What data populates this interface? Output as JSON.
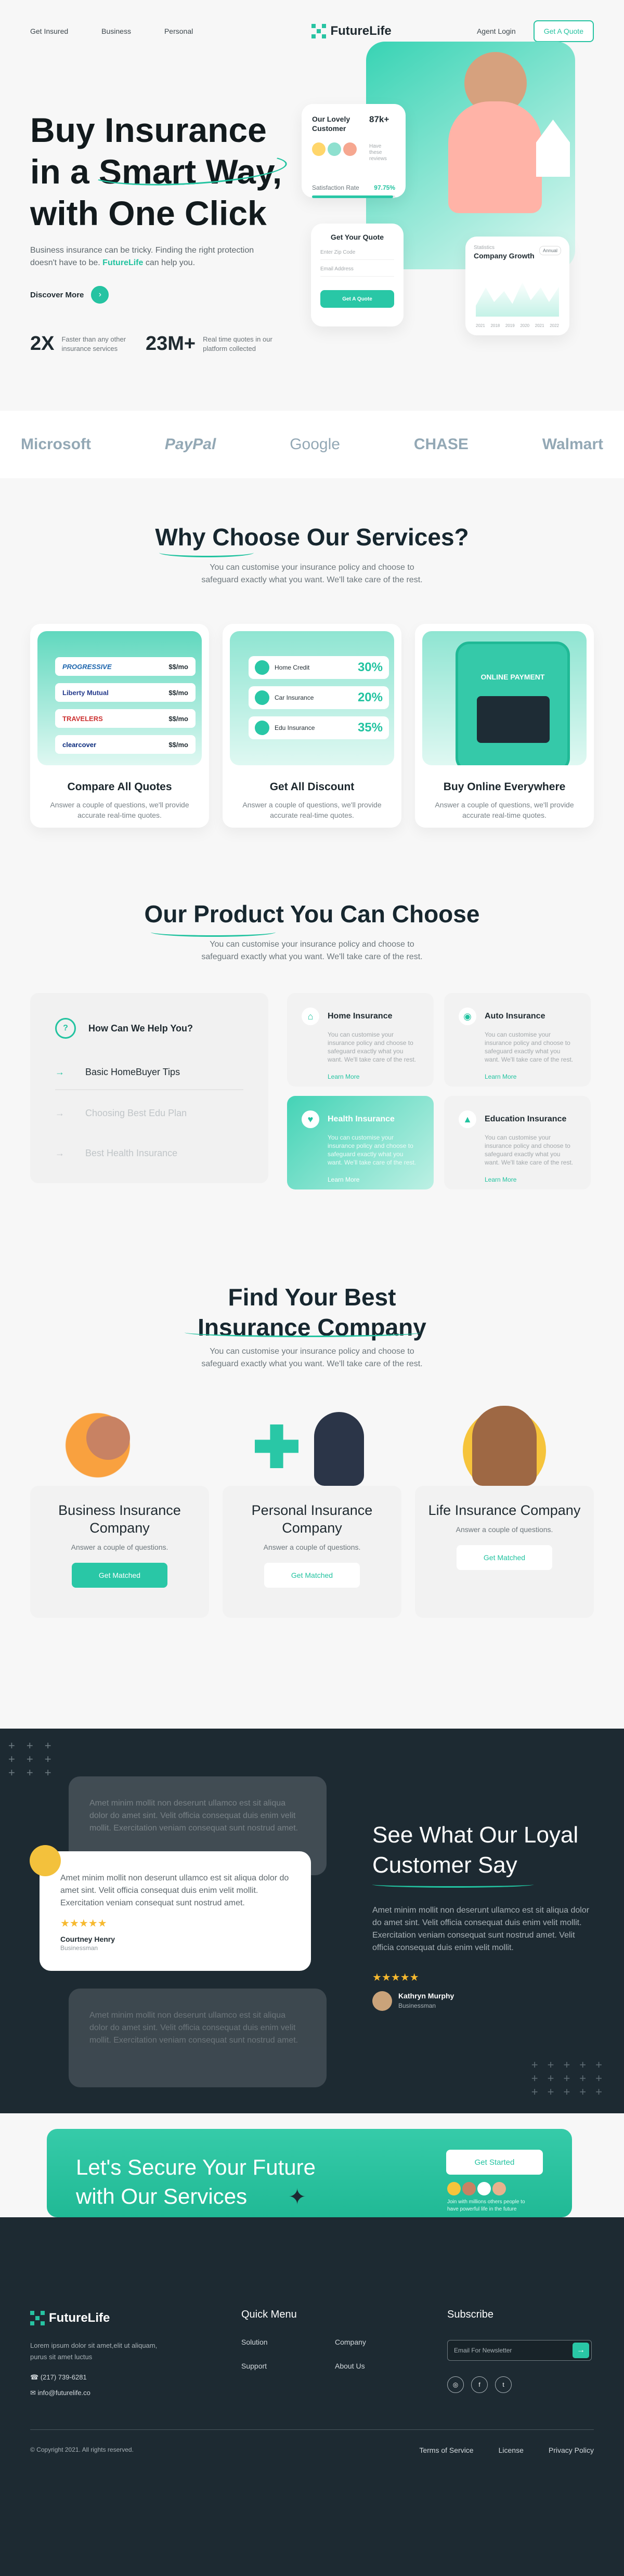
{
  "nav": {
    "links": [
      "Get Insured",
      "Business",
      "Personal"
    ],
    "logo": "FutureLife",
    "agent": "Agent Login",
    "quote": "Get A Quote"
  },
  "hero": {
    "title_1": "Buy Insurance",
    "title_2": "in a",
    "title_3": "Smart Way,",
    "title_4": "with One Click",
    "sub_1": "Business insurance can be tricky. Finding the right protection",
    "sub_2": "doesn't have to be.",
    "sub_brand": "FutureLife",
    "sub_3": "can help you.",
    "discover": "Discover More",
    "stat1": "2X",
    "stat1_text_1": "Faster than any other",
    "stat1_text_2": "insurance services",
    "stat2": "23M+",
    "stat2_text_1": "Real time quotes in our",
    "stat2_text_2": "platform collected",
    "lovely": "Our Lovely Customer",
    "count": "87k+",
    "user_text_1": "Have these",
    "user_text_2": "reviews",
    "satisfaction": "Satisfaction Rate",
    "rate": "97.75%",
    "get_quote": "Get Your Quote",
    "zip": "Enter Zip Code",
    "email": "Email Address",
    "quote_btn": "Get A Quote",
    "growth_small": "Statistics",
    "growth": "Company Growth",
    "months": [
      "2021",
      "2018",
      "2019",
      "2020",
      "2021",
      "2022"
    ],
    "period": "Annual"
  },
  "brands": [
    "Microsoft",
    "PayPal",
    "Google",
    "CHASE",
    "Walmart"
  ],
  "why": {
    "title": "Why Choose Our Services?",
    "sub_1": "You can customise your insurance policy and choose to",
    "sub_2": "safeguard exactly what you want. We'll take care of the rest.",
    "cards": [
      {
        "title": "Compare All Quotes",
        "desc_1": "Answer a couple of questions, we'll provide",
        "desc_2": "accurate real-time quotes."
      },
      {
        "title": "Get All Discount",
        "desc_1": "Answer a couple of questions, we'll provide",
        "desc_2": "accurate real-time quotes."
      },
      {
        "title": "Buy Online Everywhere",
        "desc_1": "Answer a couple of questions, we'll provide",
        "desc_2": "accurate real-time quotes."
      }
    ],
    "quotes": [
      {
        "name": "PROGRESSIVE",
        "price": "$$/mo"
      },
      {
        "name": "Liberty Mutual",
        "price": "$$/mo"
      },
      {
        "name": "TRAVELERS",
        "price": "$$/mo"
      },
      {
        "name": "clearcover",
        "price": "$$/mo"
      }
    ],
    "discounts": [
      {
        "name": "Home Credit",
        "value": "30%"
      },
      {
        "name": "Car Insurance",
        "value": "20%"
      },
      {
        "name": "Edu Insurance",
        "value": "35%"
      }
    ],
    "payment": "ONLINE PAYMENT"
  },
  "products": {
    "title": "Our Product You Can Choose",
    "sub_1": "You can customise your insurance policy and choose to",
    "sub_2": "safeguard exactly what you want. We'll take care of the rest.",
    "help": "How Can We Help You?",
    "tips": [
      "Basic HomeBuyer Tips",
      "Choosing Best Edu Plan",
      "Best Health Insurance"
    ],
    "cards": [
      {
        "title": "Home Insurance",
        "desc": "You can customise your insurance policy and choose to safeguard exactly what you want. We'll take care of the rest.",
        "link": "Learn More"
      },
      {
        "title": "Auto Insurance",
        "desc": "You can customise your insurance policy and choose to safeguard exactly what you want. We'll take care of the rest.",
        "link": "Learn More"
      },
      {
        "title": "Health Insurance",
        "desc": "You can customise your insurance policy and choose to safeguard exactly what you want. We'll take care of the rest.",
        "link": "Learn More"
      },
      {
        "title": "Education Insurance",
        "desc": "You can customise your insurance policy and choose to safeguard exactly what you want. We'll take care of the rest.",
        "link": "Learn More"
      }
    ]
  },
  "companies": {
    "title_1": "Find Your Best",
    "title_2": "Insurance Company",
    "sub_1": "You can customise your insurance policy and choose to",
    "sub_2": "safeguard exactly what you want. We'll take care of the rest.",
    "cards": [
      {
        "title": "Business Insurance Company",
        "desc": "Answer a couple of questions.",
        "btn": "Get Matched"
      },
      {
        "title": "Personal Insurance Company",
        "desc": "Answer a couple of questions.",
        "btn": "Get Matched"
      },
      {
        "title": "Life Insurance Company",
        "desc": "Answer a couple of questions.",
        "btn": "Get Matched"
      }
    ]
  },
  "testimonials": {
    "title_1": "See What Our Loyal",
    "title_2": "Customer Say",
    "text": "Amet minim mollit non deserunt ullamco est sit aliqua dolor do amet sint. Velit officia consequat duis enim velit mollit. Exercitation veniam consequat sunt nostrud amet. Velit officia consequat duis enim velit mollit.",
    "card_text": "Amet minim mollit non deserunt ullamco est sit aliqua dolor do amet sint. Velit officia consequat duis enim velit mollit. Exercitation veniam consequat sunt nostrud amet.",
    "name": "Courtney Henry",
    "role": "Businessman",
    "stars": "★★★★★",
    "right_name": "Kathryn Murphy",
    "right_role": "Businessman"
  },
  "cta": {
    "title_1": "Let's Secure Your Future",
    "title_2": "with Our Services",
    "button": "Get Started",
    "note": "Join with millions others people to have powerful life in the future"
  },
  "footer": {
    "logo": "FutureLife",
    "desc_1": "Lorem ipsum dolor sit amet,elit ut aliquam,",
    "desc_2": "purus sit amet luctus",
    "phone": "(217) 739-6281",
    "email": "info@futurelife.co",
    "quick": "Quick Menu",
    "menu": [
      "Solution",
      "Company",
      "Support",
      "About Us"
    ],
    "subscribe": "Subscribe",
    "newsletter": "Email For Newsletter",
    "copyright": "© Copyright 2021. All rights reserved.",
    "terms": "Terms of Service",
    "license": "License",
    "privacy": "Privacy Policy"
  }
}
